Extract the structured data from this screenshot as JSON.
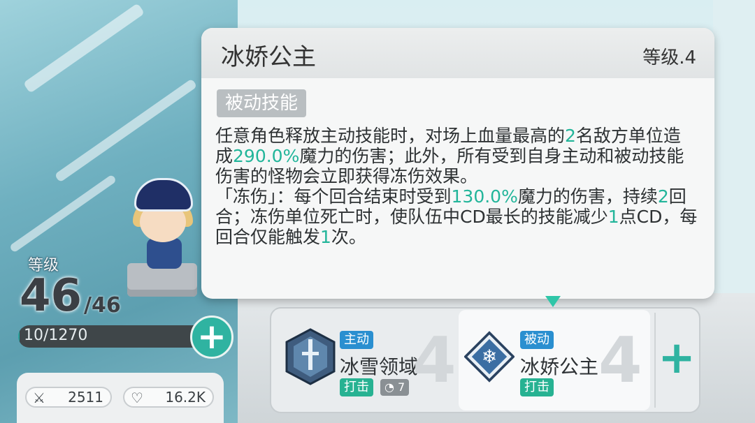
{
  "colors": {
    "accent": "#2fb3a1",
    "highlight": "#22b59a",
    "active_tag": "#2a8fd0"
  },
  "hero": {
    "level_label": "等级",
    "level": "46",
    "level_max": "/46",
    "xp_text": "10/1270",
    "xp_progress": 0.008
  },
  "stats": {
    "attack": {
      "icon": "sword-icon",
      "value": "2511"
    },
    "health": {
      "icon": "heart-icon",
      "value": "16.2K"
    }
  },
  "skills": [
    {
      "tag": "主动",
      "name": "冰雪领域",
      "type": "打击",
      "cooldown": "7",
      "level": "4",
      "icon": "sword-emblem-icon"
    },
    {
      "tag": "被动",
      "name": "冰娇公主",
      "type": "打击",
      "level": "4",
      "icon": "snowflake-emblem-icon"
    }
  ],
  "tooltip": {
    "title": "冰娇公主",
    "level": "等级.4",
    "skill_type": "被动技能",
    "desc": [
      {
        "t": "任意角色释放主动技能时，对场上血量最高的"
      },
      {
        "t": "2",
        "hl": true
      },
      {
        "t": "名敌方单位造成"
      },
      {
        "t": "290.0%",
        "hl": true
      },
      {
        "t": "魔力的伤害；此外，所有受到自身主动和被动技能伤害的怪物会立即获得冻伤效果。"
      },
      {
        "br": true
      },
      {
        "t": "「冻伤」：每个回合结束时受到"
      },
      {
        "t": "130.0%",
        "hl": true
      },
      {
        "t": "魔力的伤害，持续"
      },
      {
        "t": "2",
        "hl": true
      },
      {
        "t": "回合；冻伤单位死亡时，使队伍中CD最长的技能减少"
      },
      {
        "t": "1",
        "hl": true
      },
      {
        "t": "点CD，每回合仅能触发"
      },
      {
        "t": "1",
        "hl": true
      },
      {
        "t": "次。"
      }
    ]
  }
}
